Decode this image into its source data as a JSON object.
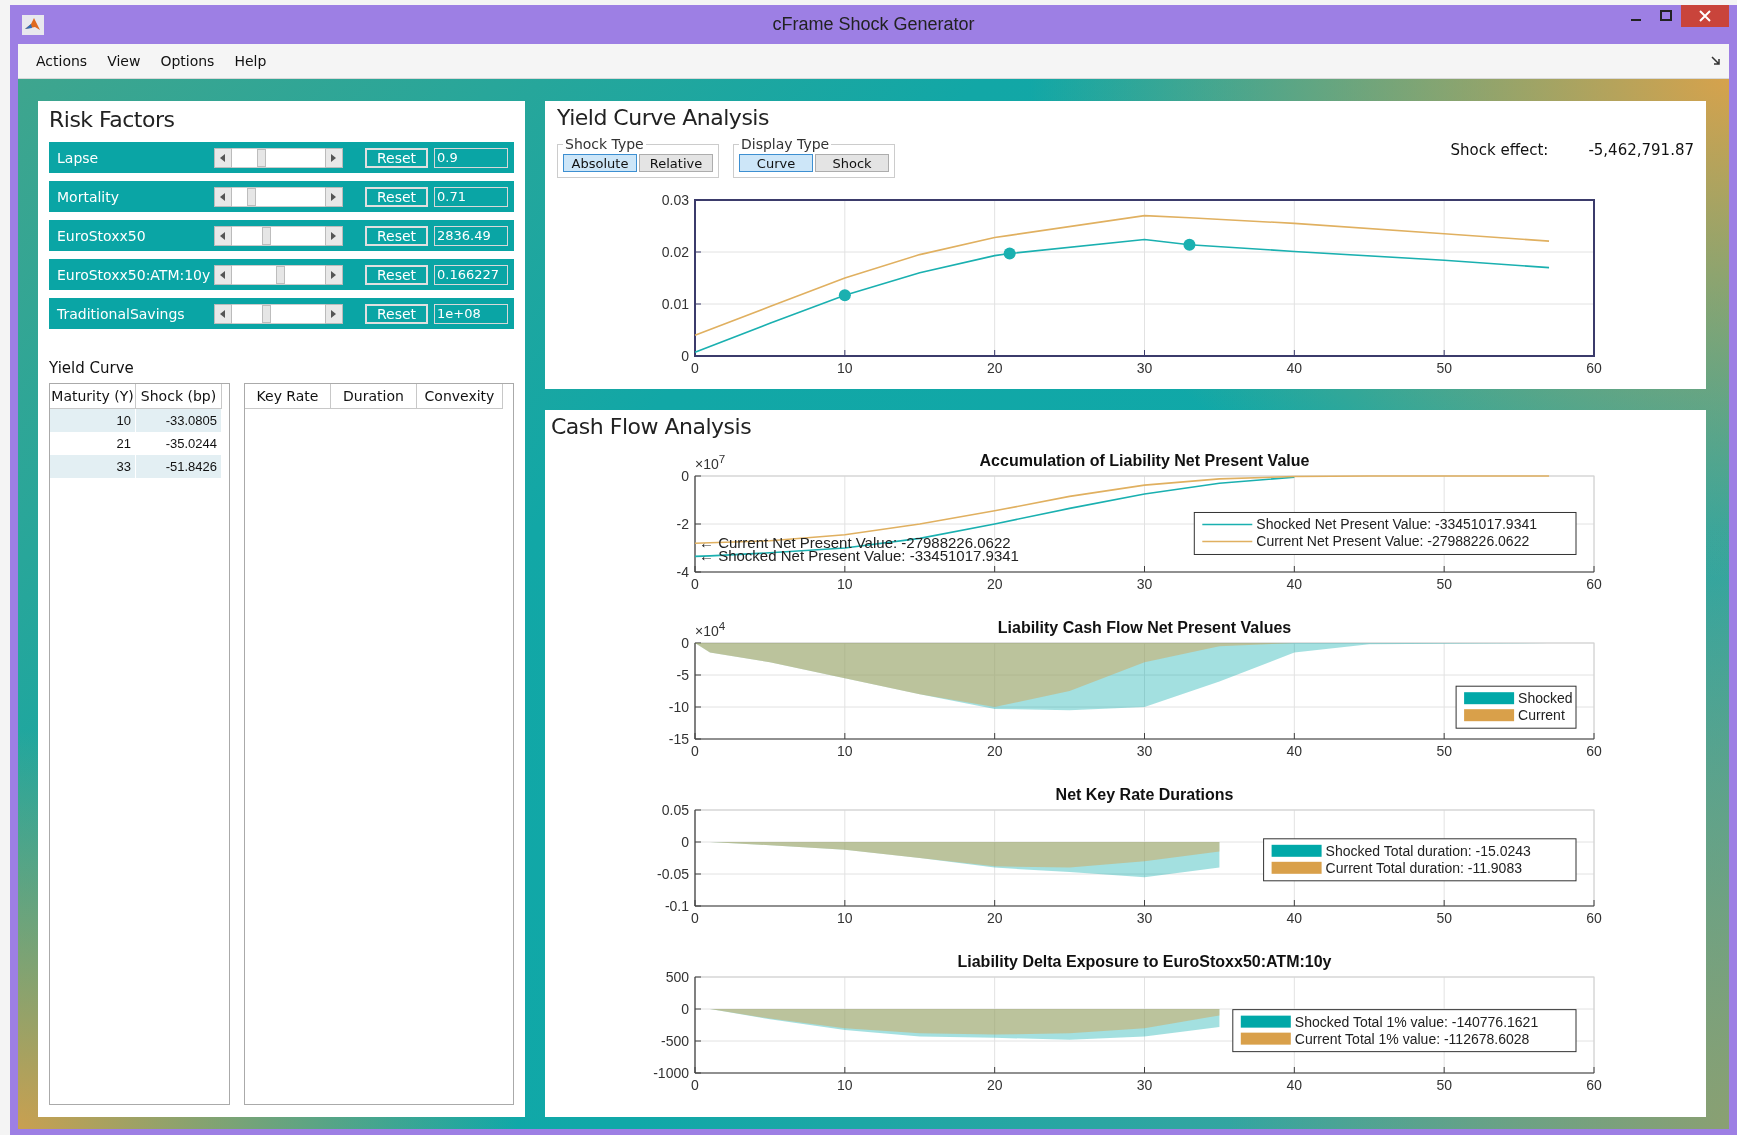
{
  "window": {
    "title": "cFrame Shock Generator"
  },
  "menu": [
    "Actions",
    "View",
    "Options",
    "Help"
  ],
  "risk_factors": {
    "title": "Risk Factors",
    "items": [
      {
        "name": "Lapse",
        "level": 0.3,
        "button": "Reset",
        "value": "0.9"
      },
      {
        "name": "Mortality",
        "level": 0.18,
        "button": "Reset",
        "value": "0.71"
      },
      {
        "name": "EuroStoxx50",
        "level": 0.36,
        "button": "Reset",
        "value": "2836.49"
      },
      {
        "name": "EuroStoxx50:ATM:10y",
        "level": 0.52,
        "button": "Reset",
        "value": "0.166227"
      },
      {
        "name": "TraditionalSavings",
        "level": 0.36,
        "button": "Reset",
        "value": "1e+08"
      }
    ]
  },
  "yield_curve_table": {
    "title": "Yield Curve",
    "columns": [
      "Maturity (Y)",
      "Shock (bp)"
    ],
    "rows": [
      [
        "10",
        "-33.0805"
      ],
      [
        "21",
        "-35.0244"
      ],
      [
        "33",
        "-51.8426"
      ]
    ]
  },
  "key_rate_table": {
    "columns": [
      "Key Rate",
      "Duration",
      "Convexity"
    ]
  },
  "yield_curve_analysis": {
    "title": "Yield Curve Analysis",
    "shock_type": {
      "label": "Shock Type",
      "options": [
        {
          "label": "Absolute",
          "selected": true
        },
        {
          "label": "Relative",
          "selected": false
        }
      ]
    },
    "display_type": {
      "label": "Display Type",
      "options": [
        {
          "label": "Curve",
          "selected": true
        },
        {
          "label": "Shock",
          "selected": false
        }
      ]
    },
    "shock_effect": {
      "label": "Shock effect:",
      "value": "-5,462,791.87"
    },
    "chart_data": {
      "type": "line",
      "x": [
        0,
        5,
        10,
        15,
        20,
        21,
        30,
        33,
        40,
        50,
        57
      ],
      "xlim": [
        0,
        60
      ],
      "ylim": [
        0,
        0.03
      ],
      "xticks": [
        0,
        10,
        20,
        30,
        40,
        50,
        60
      ],
      "yticks": [
        0,
        0.01,
        0.02,
        0.03
      ],
      "grid": true,
      "series": [
        {
          "color": "#e0b060",
          "values": [
            0.004,
            0.0095,
            0.015,
            0.0195,
            0.0228,
            0.0232,
            0.027,
            0.0266,
            0.0255,
            0.0235,
            0.0221
          ]
        },
        {
          "color": "#1ab0b0",
          "values": [
            0.0007,
            0.0063,
            0.0117,
            0.016,
            0.0193,
            0.0197,
            0.0224,
            0.0214,
            0.0201,
            0.0184,
            0.017
          ]
        }
      ]
    }
  },
  "cash_flow_analysis": {
    "title": "Cash Flow Analysis",
    "charts": [
      {
        "multiplier": "×10$^{7}$",
        "chart_data": {
          "type": "line",
          "title": "Accumulation of Liability Net Present Value",
          "x": [
            0,
            1,
            5,
            10,
            15,
            20,
            25,
            30,
            35,
            40,
            45,
            57
          ],
          "xlim": [
            0,
            60
          ],
          "ylim": [
            -4,
            0
          ],
          "xticks": [
            0,
            10,
            20,
            30,
            40,
            50,
            60
          ],
          "yticks": [
            0,
            -2,
            -4
          ],
          "grid": true,
          "legend": true,
          "annotations": [
            {
              "text": "← Current Net Present Value: -27988226.0622"
            },
            {
              "text": "← Shocked Net Present Value: -33451017.9341"
            }
          ],
          "series": [
            {
              "name": "Shocked Net Present Value: -33451017.9341",
              "color": "#1ab0b0",
              "values": [
                -3.35,
                -3.33,
                -3.2,
                -3.0,
                -2.6,
                -2.0,
                -1.35,
                -0.75,
                -0.3,
                -0.05,
                null,
                null
              ]
            },
            {
              "name": "Current Net Present Value: -27988226.0622",
              "color": "#e0b060",
              "values": [
                -2.8,
                -2.78,
                -2.7,
                -2.45,
                -2.0,
                -1.45,
                -0.85,
                -0.38,
                -0.12,
                -0.02,
                0,
                0
              ]
            }
          ]
        }
      },
      {
        "multiplier": "×10$^{4}$",
        "chart_data": {
          "type": "area",
          "title": "Liability Cash Flow Net Present Values",
          "x": [
            0,
            1,
            5,
            10,
            15,
            20,
            25,
            30,
            35,
            40,
            45,
            57
          ],
          "xlim": [
            0,
            60
          ],
          "ylim": [
            -15,
            0
          ],
          "xticks": [
            0,
            10,
            20,
            30,
            40,
            50,
            60
          ],
          "yticks": [
            0,
            -5,
            -10,
            -15
          ],
          "grid": true,
          "legend": true,
          "series": [
            {
              "name": "Shocked",
              "color": "#00a8a8",
              "values": [
                0,
                -1.5,
                -3,
                -5.5,
                -8,
                -10.3,
                -10.5,
                -10,
                -6,
                -1.5,
                -0.2,
                0
              ]
            },
            {
              "name": "Current",
              "color": "#d9a04a",
              "values": [
                0,
                -1.5,
                -3,
                -5.5,
                -8,
                -10,
                -7.5,
                -3,
                -0.5,
                0,
                0,
                0
              ]
            }
          ]
        }
      },
      {
        "chart_data": {
          "type": "area",
          "title": "Net Key Rate Durations",
          "x": [
            0,
            1,
            5,
            10,
            15,
            20,
            25,
            30,
            35
          ],
          "xlim": [
            0,
            60
          ],
          "ylim": [
            -0.1,
            0.05
          ],
          "xticks": [
            0,
            10,
            20,
            30,
            40,
            50,
            60
          ],
          "yticks": [
            0.05,
            0,
            -0.05,
            -0.1
          ],
          "grid": true,
          "legend": true,
          "series": [
            {
              "name": "Shocked Total duration: -15.0243",
              "color": "#00a8a8",
              "values": [
                0,
                0,
                -0.005,
                -0.012,
                -0.025,
                -0.04,
                -0.047,
                -0.055,
                -0.04
              ]
            },
            {
              "name": "Current Total duration: -11.9083",
              "color": "#d9a04a",
              "values": [
                0,
                0,
                -0.005,
                -0.012,
                -0.025,
                -0.038,
                -0.04,
                -0.03,
                -0.015
              ]
            }
          ]
        }
      },
      {
        "chart_data": {
          "type": "area",
          "title": "Liability Delta Exposure to EuroStoxx50:ATM:10y",
          "x": [
            0,
            1,
            5,
            10,
            15,
            20,
            25,
            30,
            35
          ],
          "xlim": [
            0,
            60
          ],
          "ylim": [
            -1000,
            500
          ],
          "xticks": [
            0,
            10,
            20,
            30,
            40,
            50,
            60
          ],
          "yticks": [
            500,
            0,
            -500,
            -1000
          ],
          "grid": true,
          "legend": true,
          "series": [
            {
              "name": "Shocked Total 1% value: -140776.1621",
              "color": "#00a8a8",
              "values": [
                0,
                0,
                -160,
                -330,
                -430,
                -450,
                -480,
                -430,
                -280
              ]
            },
            {
              "name": "Current Total 1% value: -112678.6028",
              "color": "#d9a04a",
              "values": [
                0,
                0,
                -150,
                -300,
                -380,
                -400,
                -380,
                -300,
                -100
              ]
            }
          ]
        }
      }
    ]
  }
}
